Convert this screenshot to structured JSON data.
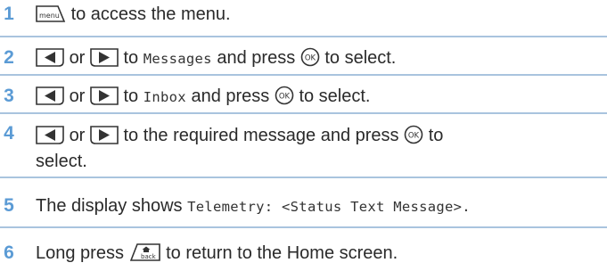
{
  "colors": {
    "step_number": "#5b9bd5",
    "divider": "#a9c4de",
    "text": "#2a2a2a"
  },
  "icons": {
    "menu_key": "menu-key-icon",
    "left_key": "left-arrow-key-icon",
    "right_key": "right-arrow-key-icon",
    "ok_key": "ok-key-icon",
    "back_key": "back-home-key-icon"
  },
  "menu_key_label": "menu",
  "back_key_label": "back",
  "ok_key_label": "OK",
  "steps": [
    {
      "number": "1",
      "text": "to access the menu."
    },
    {
      "number": "2",
      "or": "or",
      "to": "to",
      "target": "Messages",
      "and_press": "and press",
      "tail": "to select."
    },
    {
      "number": "3",
      "or": "or",
      "to": "to",
      "target": "Inbox",
      "and_press": "and press",
      "tail": "to select."
    },
    {
      "number": "4",
      "or": "or",
      "mid": "to the required message and press",
      "tail": "to",
      "line2": "select."
    },
    {
      "number": "5",
      "text": "The display shows",
      "mono": "Telemetry: <Status Text Message>."
    },
    {
      "number": "6",
      "prefix": "Long press",
      "suffix": "to return to the Home screen."
    }
  ]
}
